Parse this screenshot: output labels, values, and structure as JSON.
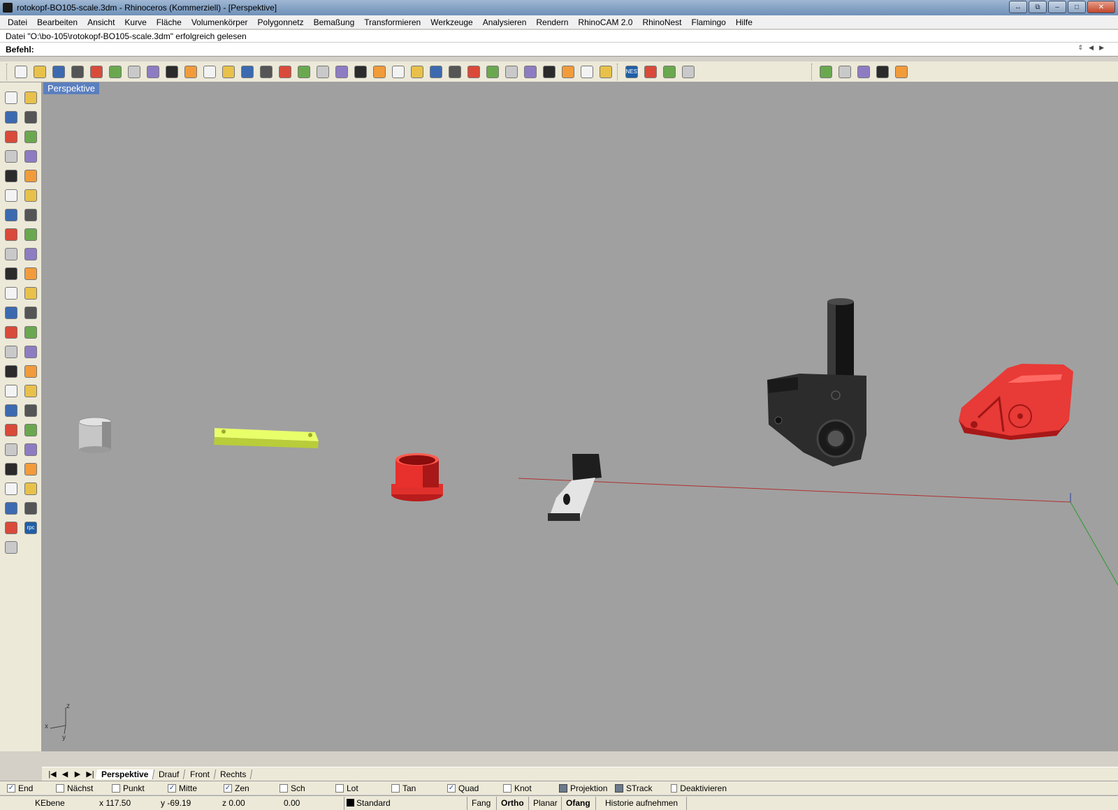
{
  "window": {
    "title": "rotokopf-BO105-scale.3dm - Rhinoceros (Kommerziell) - [Perspektive]",
    "controls": [
      "↔",
      "⧉",
      "–",
      "□",
      "✕"
    ]
  },
  "menu": [
    "Datei",
    "Bearbeiten",
    "Ansicht",
    "Kurve",
    "Fläche",
    "Volumenkörper",
    "Polygonnetz",
    "Bemaßung",
    "Transformieren",
    "Werkzeuge",
    "Analysieren",
    "Rendern",
    "RhinoCAM 2.0",
    "RhinoNest",
    "Flamingo",
    "Hilfe"
  ],
  "command": {
    "history": "Datei \"O:\\bo-105\\rotokopf-BO105-scale.3dm\" erfolgreich gelesen",
    "prompt_label": "Befehl:",
    "value": ""
  },
  "toolbar": {
    "main_icons": [
      "new-icon",
      "open-icon",
      "save-icon",
      "print-icon",
      "import-icon",
      "cut-icon",
      "copy-icon",
      "paste-icon",
      "undo-icon",
      "pan-hand-icon",
      "rotate-view-icon",
      "zoom-icon",
      "zoom-window-icon",
      "zoom-extents-icon",
      "zoom-selected-icon",
      "undo-view-icon",
      "four-viewports-icon",
      "car-icon",
      "cplane-icon",
      "osnap-icon",
      "grid-icon",
      "lightbulb-icon",
      "lock-icon",
      "layer-icon",
      "color-wheel-icon",
      "wireframe-icon",
      "shaded-icon",
      "render-sphere-icon",
      "sun-icon",
      "gear-icon",
      "dimension-icon",
      "help-icon"
    ],
    "nest_icons": [
      "nest-icon",
      "hammer-icon",
      "play-icon",
      "help-icon"
    ],
    "flamingo_icons": [
      "flamingo-icon",
      "paint-brush-icon",
      "leaf-icon",
      "magnifier-icon",
      "globe-icon"
    ],
    "nest_label": "NEST"
  },
  "sidebar": {
    "icons": [
      "select-icon",
      "point-icon",
      "polyline-icon",
      "curve-icon",
      "circle-icon",
      "ellipse-icon",
      "arc-icon",
      "rectangle-icon",
      "polygon-icon",
      "fillet-icon",
      "surface-icon",
      "revolve-icon",
      "box-icon",
      "sphere-icon",
      "cylinder-icon",
      "loft-icon",
      "explode-icon",
      "trim-icon",
      "split-icon",
      "join-icon",
      "boolean-icon",
      "group-icon",
      "move-icon",
      "rotate-icon",
      "text-icon",
      "scale-icon",
      "array-icon",
      "mirror-icon",
      "block-icon",
      "analyze-icon",
      "render-green-icon",
      "render-preview-icon",
      "material-icon",
      "environment-icon",
      "texture-icon",
      "light-icon",
      "flamingo-icon",
      "spot-icon",
      "magnify-icon",
      "shade-icon",
      "plant-icon",
      "camera-icon",
      "checker-icon",
      "export-icon",
      "leaf-icon",
      "rpc-icon",
      "help-icon"
    ],
    "rpc_label": "rpc"
  },
  "viewport": {
    "label": "Perspektive",
    "axis": {
      "x": "x",
      "y": "y",
      "z": "z"
    }
  },
  "tabs": {
    "nav": [
      "|◀",
      "◀",
      "▶",
      "▶|"
    ],
    "items": [
      "Perspektive",
      "Drauf",
      "Front",
      "Rechts"
    ],
    "active": "Perspektive"
  },
  "osnap": [
    {
      "label": "End",
      "checked": true
    },
    {
      "label": "Nächst",
      "checked": false
    },
    {
      "label": "Punkt",
      "checked": false
    },
    {
      "label": "Mitte",
      "checked": true
    },
    {
      "label": "Zen",
      "checked": true
    },
    {
      "label": "Sch",
      "checked": false
    },
    {
      "label": "Lot",
      "checked": false
    },
    {
      "label": "Tan",
      "checked": false
    },
    {
      "label": "Quad",
      "checked": true
    },
    {
      "label": "Knot",
      "checked": false
    },
    {
      "label": "Projektion",
      "checked": false
    },
    {
      "label": "STrack",
      "checked": false
    },
    {
      "label": "Deaktivieren",
      "checked": false
    }
  ],
  "status": {
    "cplane": "KEbene",
    "x": "x 117.50",
    "y": "y -69.19",
    "z": "z 0.00",
    "distance": "0.00",
    "layer": "Standard",
    "fang": "Fang",
    "ortho": "Ortho",
    "planar": "Planar",
    "ofang": "Ofang",
    "history": "Historie aufnehmen"
  },
  "colors": {
    "viewport_bg": "#a0a0a0",
    "viewport_label_bg": "#5b7fbf",
    "red_part": "#e8302c",
    "yellow_part": "#d4f23a",
    "black_part": "#2a2a2a",
    "x_axis": "#b03030",
    "y_axis": "#2a9a2a"
  }
}
